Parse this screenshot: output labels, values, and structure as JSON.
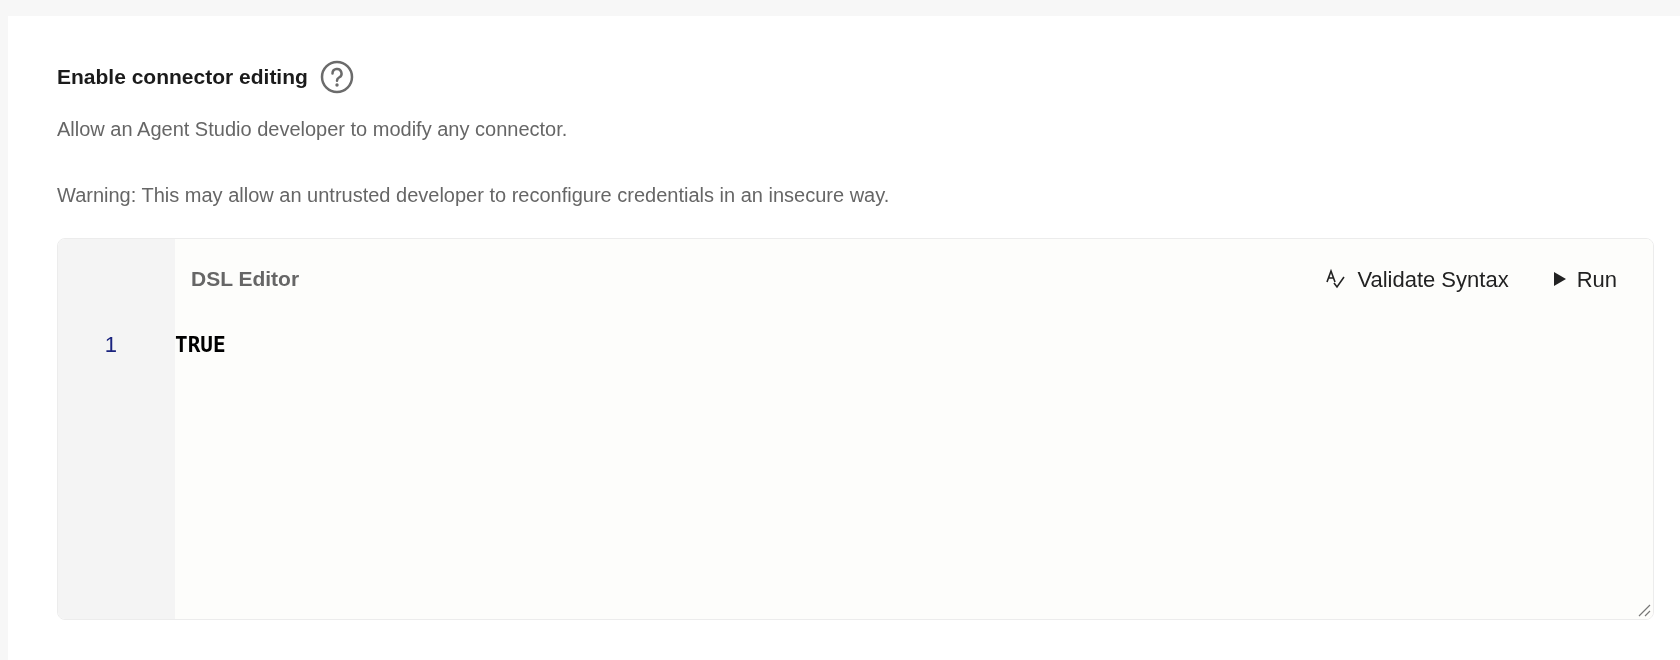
{
  "setting": {
    "title": "Enable connector editing",
    "description": "Allow an Agent Studio developer to modify any connector.",
    "warning": "Warning: This may allow an untrusted developer to reconfigure credentials in an insecure way."
  },
  "editor": {
    "title": "DSL Editor",
    "actions": [
      {
        "kind": "validate",
        "label": "Validate Syntax"
      },
      {
        "kind": "run",
        "label": "Run"
      }
    ],
    "lines": [
      {
        "number": "1",
        "code": "TRUE"
      }
    ]
  }
}
